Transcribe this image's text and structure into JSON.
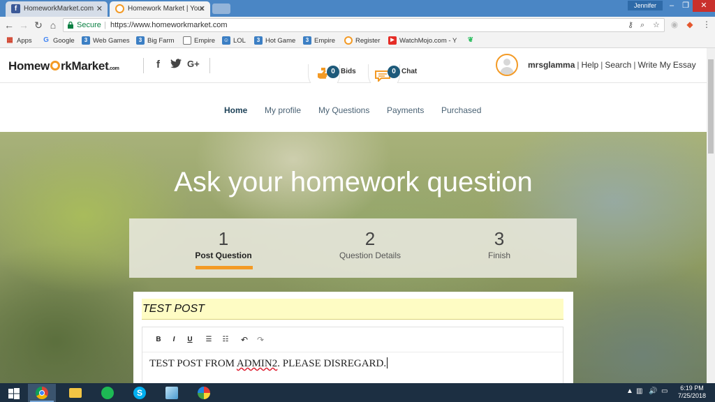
{
  "browser": {
    "tabs": [
      {
        "title": "HomeworkMarket.com",
        "favicon": "facebook-icon",
        "active": false
      },
      {
        "title": "Homework Market | Your",
        "favicon": "hwm-icon",
        "active": true
      }
    ],
    "user_chip": "Jennifer",
    "secure_label": "Secure",
    "url": "https://www.homeworkmarket.com",
    "bookmarks": [
      "Apps",
      "Google",
      "Web Games",
      "Big Farm",
      "Empire",
      "LOL",
      "Hot Game",
      "Empire",
      "Register",
      "WatchMojo.com - Y"
    ]
  },
  "header": {
    "logo": {
      "part1": "Homew",
      "part2": "rkMarket",
      "suffix": ".com"
    },
    "social": {
      "facebook": "f",
      "twitter": "🐦",
      "google": "G+"
    },
    "bids": {
      "count": "0",
      "label": "Bids"
    },
    "chat": {
      "count": "0",
      "label": "Chat"
    },
    "username": "mrsglamma",
    "links": [
      "Help",
      "Search",
      "Write My Essay"
    ]
  },
  "nav": {
    "items": [
      "Home",
      "My profile",
      "My Questions",
      "Payments",
      "Purchased"
    ],
    "active": "Home"
  },
  "hero": {
    "title": "Ask your homework question",
    "steps": [
      {
        "num": "1",
        "label": "Post Question"
      },
      {
        "num": "2",
        "label": "Question Details"
      },
      {
        "num": "3",
        "label": "Finish"
      }
    ],
    "current_step": 1
  },
  "form": {
    "title_value": "TEST POST",
    "body_prefix": "TEST POST FROM ",
    "body_misspelled": "ADMIN2",
    "body_suffix": ". PLEASE DISREGARD."
  },
  "taskbar": {
    "time": "6:19 PM",
    "date": "7/25/2018"
  },
  "colors": {
    "accent": "#f39a25",
    "badge": "#1e5a7a",
    "title_bar": "#4a86c5",
    "taskbar": "#1c2f42"
  }
}
